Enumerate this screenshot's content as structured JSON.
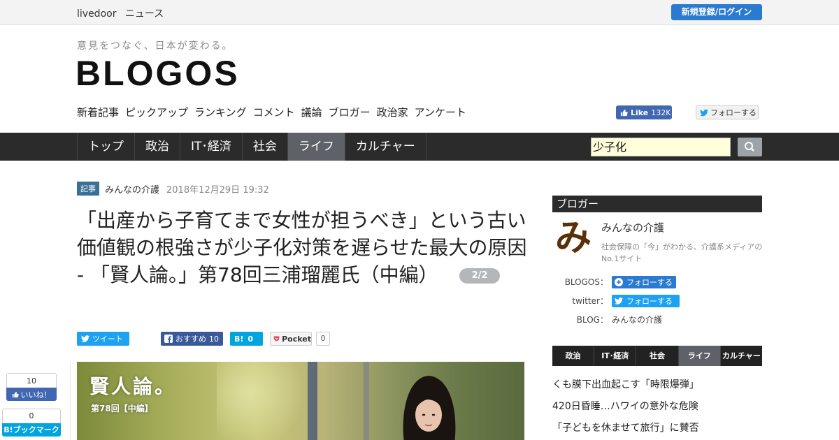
{
  "topbar": {
    "brand": "livedoor",
    "news": "ニュース",
    "login": "新規登録/ログイン"
  },
  "header": {
    "tagline": "意見をつなぐ、日本が変わる。",
    "logo": "BLOGOS",
    "subnav": [
      "新着記事",
      "ピックアップ",
      "ランキング",
      "コメント",
      "議論",
      "ブロガー",
      "政治家",
      "アンケート"
    ],
    "fb_like": {
      "label": "Like",
      "count": "132K"
    },
    "tw_follow": "フォローする"
  },
  "mainnav": {
    "items": [
      "トップ",
      "政治",
      "IT･経済",
      "社会",
      "ライフ",
      "カルチャー"
    ],
    "active_index": 4
  },
  "search": {
    "value": "少子化"
  },
  "article": {
    "tag": "記事",
    "author": "みんなの介護",
    "date": "2018年12月29日 19:32",
    "title": "「出産から子育てまで女性が担うべき」という古い価値観の根強さが少子化対策を遅らせた最大の原因 - 「賢人論。」第78回三浦瑠麗氏（中編）",
    "page": "2/2",
    "share": {
      "tweet": "ツイート",
      "fb_recommend": "おすすめ",
      "fb_count": "10",
      "hatena_count": "0",
      "pocket": "Pocket",
      "pocket_count": "0"
    },
    "hero": {
      "caption": "賢人論。",
      "sub": "第78回【中編】"
    }
  },
  "floating": {
    "like_count": "10",
    "like_label": "いいね！",
    "hatena_count": "0",
    "hatena_label": "B!ブックマーク"
  },
  "sidebar": {
    "head": "ブロガー",
    "icon_char": "み",
    "name": "みんなの介護",
    "desc": "社会保障の「今」がわかる、介護系メディアのNo.1サイト",
    "blogos_label": "BLOGOS：",
    "twitter_label": "twitter：",
    "blog_label": "BLOG：",
    "follow": "フォローする",
    "blog_value": "みんなの介護",
    "cat_tabs": [
      "政治",
      "IT･経済",
      "社会",
      "ライフ",
      "カルチャー"
    ],
    "cat_active": 3,
    "list": [
      "くも膜下出血起こす「時限爆弾」",
      "420日昏睡…ハワイの意外な危険",
      "「子どもを休ませて旅行」に賛否"
    ]
  }
}
